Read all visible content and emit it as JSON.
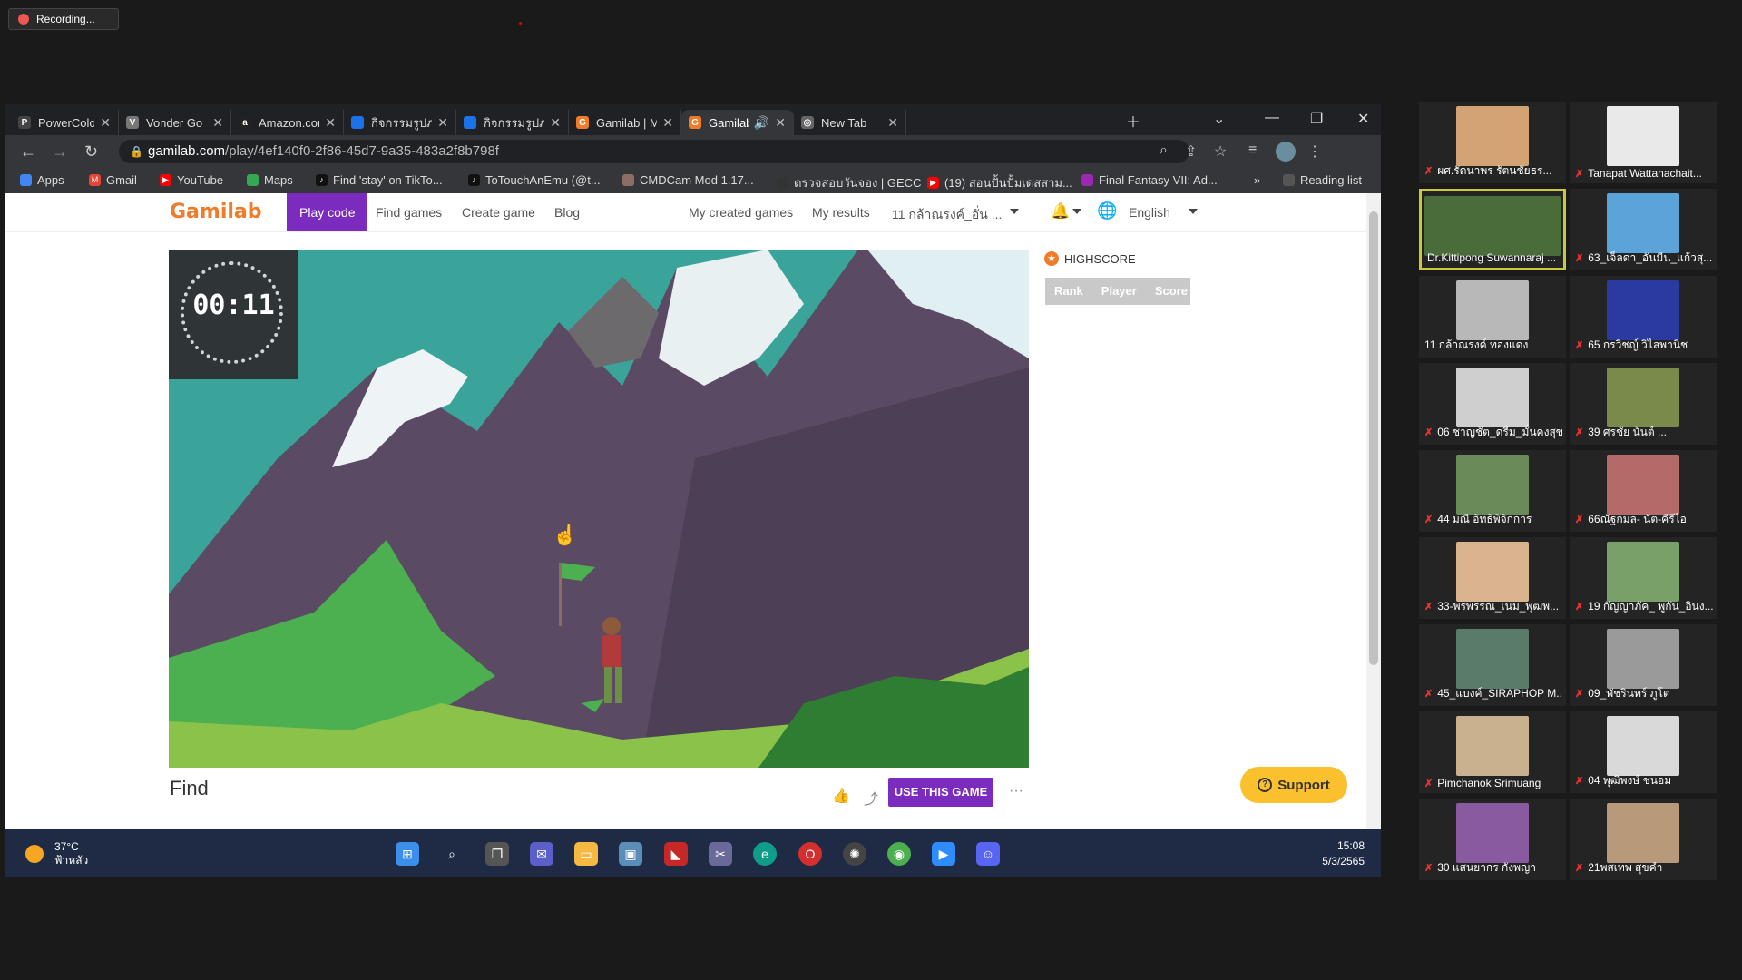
{
  "recording": {
    "label": "Recording..."
  },
  "browser": {
    "tabs": [
      {
        "title": "PowerColor x",
        "favicon": "#444",
        "letter": "P"
      },
      {
        "title": "Vonder Go",
        "favicon": "#777",
        "letter": "V"
      },
      {
        "title": "Amazon.com:",
        "favicon": "#222",
        "letter": "a"
      },
      {
        "title": "กิจกรรมรูปภาพ",
        "favicon": "#1a73e8",
        "letter": ""
      },
      {
        "title": "กิจกรรมรูปภาพ",
        "favicon": "#1a73e8",
        "letter": ""
      },
      {
        "title": "Gamilab | MC",
        "favicon": "#f07c2a",
        "letter": "G"
      },
      {
        "title": "Gamilab",
        "favicon": "#f07c2a",
        "letter": "G"
      },
      {
        "title": "New Tab",
        "favicon": "#666",
        "letter": "◎"
      }
    ],
    "url_host": "gamilab.com",
    "url_path": "/play/4ef140f0-2f86-45d7-9a35-483a2f8b798f",
    "bookmarks": [
      {
        "label": "Apps",
        "color": "#4285f4"
      },
      {
        "label": "Gmail",
        "color": "#ea4335"
      },
      {
        "label": "YouTube",
        "color": "#ff0000"
      },
      {
        "label": "Maps",
        "color": "#34a853"
      },
      {
        "label": "Find 'stay' on TikTo...",
        "color": "#111"
      },
      {
        "label": "ToTouchAnEmu (@t...",
        "color": "#111"
      },
      {
        "label": "CMDCam Mod 1.17...",
        "color": "#8d6e63"
      },
      {
        "label": "ตรวจสอบวันจอง | GECC",
        "color": "#333"
      },
      {
        "label": "(19) สอนปั้นปั้มเดสสาม...",
        "color": "#ff0000"
      },
      {
        "label": "Final Fantasy VII: Ad...",
        "color": "#9c27b0"
      }
    ],
    "reading_list": "Reading list"
  },
  "site": {
    "logo": "Gamilab",
    "nav": {
      "play_code": "Play code",
      "find_games": "Find games",
      "create_game": "Create game",
      "blog": "Blog",
      "my_created_games": "My created games",
      "my_results": "My results",
      "user": "11 กล้าณรงค์_อั่น ...",
      "language": "English"
    },
    "game": {
      "timer": "00:11",
      "title": "Find"
    },
    "highscore": {
      "title": "HIGHSCORE",
      "cols": [
        "Rank",
        "Player",
        "Score"
      ]
    },
    "use_game": "USE THIS GAME",
    "more": "···",
    "support": "Support"
  },
  "taskbar": {
    "temp": "37°C",
    "weather": "ฟ้าหลัว",
    "time": "15:08",
    "date": "5/3/2565"
  },
  "participants": [
    {
      "name": "ผศ.รัตนาพร รัตนชัยธร...",
      "muted": true,
      "color": "#d4a373"
    },
    {
      "name": "Tanapat Wattanachait...",
      "muted": true,
      "color": "#e9e9e9"
    },
    {
      "name": "Dr.Kittipong Suwannaraj ...",
      "muted": false,
      "color": "#4a6b3a"
    },
    {
      "name": "63_เจ็ลดา_อันมีน_แก้วสุ...",
      "muted": true,
      "color": "#5ba4d9"
    },
    {
      "name": "11 กล้าณรงค์ ทองแดง",
      "muted": false,
      "color": "#b8b8b8"
    },
    {
      "name": "65 กรวิชญ์ วิไลพานิช",
      "muted": true,
      "color": "#2a3aa0"
    },
    {
      "name": "06 ชาญชัต_ดรีม_มั่นคงสุข",
      "muted": true,
      "color": "#cfcfcf"
    },
    {
      "name": "39 ศรชัย นันต์ ...",
      "muted": true,
      "color": "#7a8a4a"
    },
    {
      "name": "44 มณี อิทธิพิจิกการ",
      "muted": true,
      "color": "#6a8a5a"
    },
    {
      "name": "66ณัฐกมล- นัต-คีรีไอ",
      "muted": true,
      "color": "#b56a6a"
    },
    {
      "name": "33-พรพรรณ_เนม_พุฒพ...",
      "muted": true,
      "color": "#d9b48f"
    },
    {
      "name": "19 กัญญาภัค_ พูกัน_อินง...",
      "muted": true,
      "color": "#7aa06a"
    },
    {
      "name": "45_แบงค์_SIRAPHOP M...",
      "muted": true,
      "color": "#5a7a6a"
    },
    {
      "name": "09_พัชรินทร์ ภูโต",
      "muted": true,
      "color": "#9a9a9a"
    },
    {
      "name": "Pimchanok Srimuang",
      "muted": true,
      "color": "#c9b08f"
    },
    {
      "name": "04 พุฒิพงษ์ ชนอม",
      "muted": true,
      "color": "#d9d9d9"
    },
    {
      "name": "30 แสนยากร กังพญา",
      "muted": true,
      "color": "#8a5aa0"
    },
    {
      "name": "21พสเทพ สุขคำ",
      "muted": true,
      "color": "#b89a7a"
    }
  ]
}
